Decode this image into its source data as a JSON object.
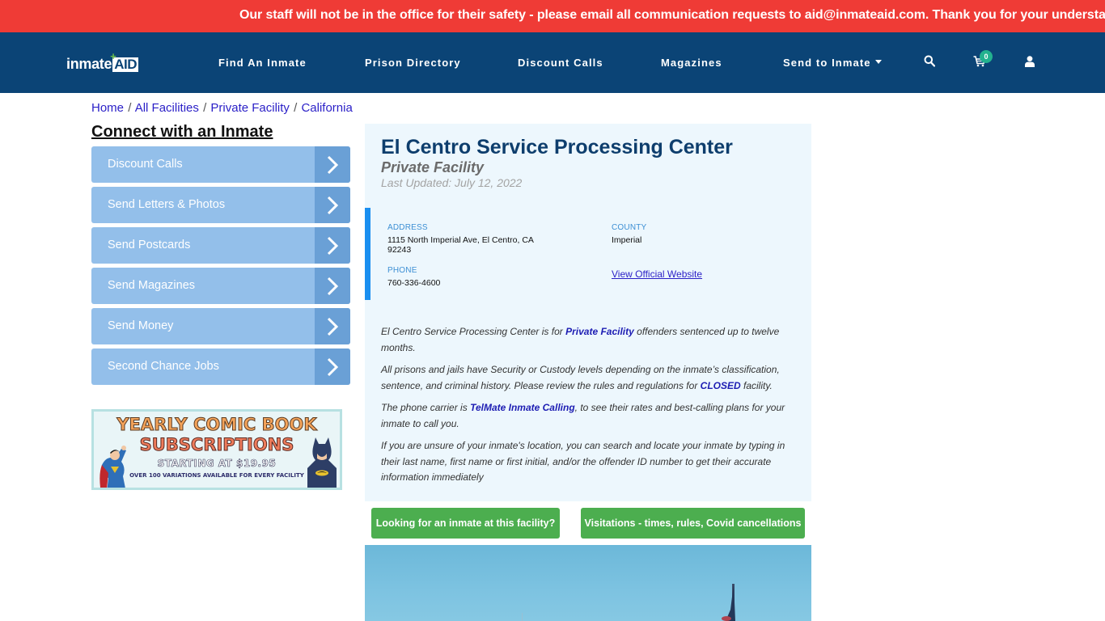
{
  "alert": {
    "text": "Our staff will not be in the office for their safety - please email all communication requests to aid@inmateaid.com. Thank you for your understanding."
  },
  "colors": {
    "alert_bg": "#ef3b36",
    "nav_bg": "#0b4476",
    "sidebar_item_bg": "#93bfea",
    "sidebar_arrow_bg": "#6aa0d6",
    "card_bg": "#edf7fd",
    "accent_blue": "#1a8ff0",
    "button_green": "#4cae4f",
    "cart_badge": "#23b28f"
  },
  "navbar": {
    "logo": {
      "word": "inmate",
      "mark": "AID",
      "plus": "+"
    },
    "links": [
      {
        "label": "Find An Inmate"
      },
      {
        "label": "Prison Directory"
      },
      {
        "label": "Discount Calls"
      },
      {
        "label": "Magazines"
      },
      {
        "label": "Send to Inmate",
        "has_dropdown": true
      }
    ],
    "icons": [
      "search-icon",
      "cart-icon",
      "user-icon"
    ],
    "cart_count": "0"
  },
  "breadcrumb": [
    {
      "label": "Home"
    },
    {
      "label": "All Facilities"
    },
    {
      "label": "Private Facility"
    },
    {
      "label": "California"
    }
  ],
  "breadcrumb_separator": "/",
  "sidebar": {
    "title": "Connect with an Inmate",
    "items": [
      {
        "label": "Discount Calls"
      },
      {
        "label": "Send Letters & Photos"
      },
      {
        "label": "Send Postcards"
      },
      {
        "label": "Send Magazines"
      },
      {
        "label": "Send Money"
      },
      {
        "label": "Second Chance Jobs"
      }
    ],
    "ad": {
      "line1": "YEARLY COMIC BOOK",
      "line2": "SUBSCRIPTIONS",
      "line3": "STARTING AT $19.95",
      "line4": "OVER 100 VARIATIONS AVAILABLE FOR EVERY FACILITY"
    }
  },
  "facility": {
    "name": "El Centro Service Processing Center",
    "type": "Private Facility",
    "last_updated": "Last Updated: July 12, 2022",
    "address_label": "ADDRESS",
    "address_line1": "1115 North Imperial Ave, El Centro, CA",
    "address_line2": "92243",
    "county_label": "COUNTY",
    "county": "Imperial",
    "phone_label": "PHONE",
    "phone": "760-336-4600",
    "website_link": "View Official Website"
  },
  "description": {
    "p1_a": "El Centro Service Processing Center is for ",
    "p1_link": "Private Facility",
    "p1_b": " offenders sentenced up to twelve months.",
    "p2_a": "All prisons and jails have Security or Custody levels depending on the inmate’s classification, sentence, and criminal history. Please review the rules and regulations for ",
    "p2_link": "CLOSED",
    "p2_b": " facility.",
    "p3_a": "The phone carrier is ",
    "p3_link": "TelMate Inmate Calling",
    "p3_b": ", to see their rates and best-calling plans for your inmate to call you.",
    "p4": "If you are unsure of your inmate's location, you can search and locate your inmate by typing in their last name, first name or first initial, and/or the offender ID number to get their accurate information immediately"
  },
  "buttons": {
    "find_inmate": "Looking for an inmate at this facility?",
    "visitations": "Visitations - times, rules, Covid cancellations"
  }
}
